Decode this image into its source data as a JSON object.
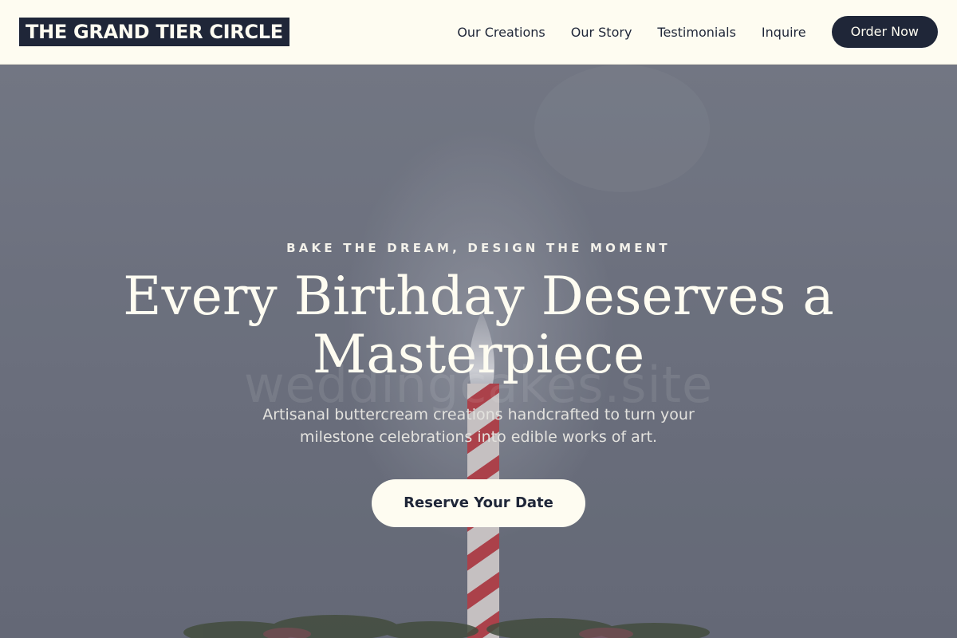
{
  "header": {
    "logo": "THE GRAND TIER CIRCLE",
    "nav": [
      {
        "label": "Our Creations"
      },
      {
        "label": "Our Story"
      },
      {
        "label": "Testimonials"
      },
      {
        "label": "Inquire"
      }
    ],
    "order_label": "Order Now"
  },
  "hero": {
    "eyebrow": "BAKE THE DREAM, DESIGN THE MOMENT",
    "headline": "Every Birthday Deserves a Masterpiece",
    "subtext": "Artisanal buttercream creations handcrafted to turn your milestone celebrations into edible works of art.",
    "cta_label": "Reserve Your Date",
    "watermark": "weddingcakes.site"
  },
  "colors": {
    "navy": "#1f2638",
    "cream": "#fefcf1",
    "overlay": "#70747f",
    "candle_red": "#c8343c"
  }
}
